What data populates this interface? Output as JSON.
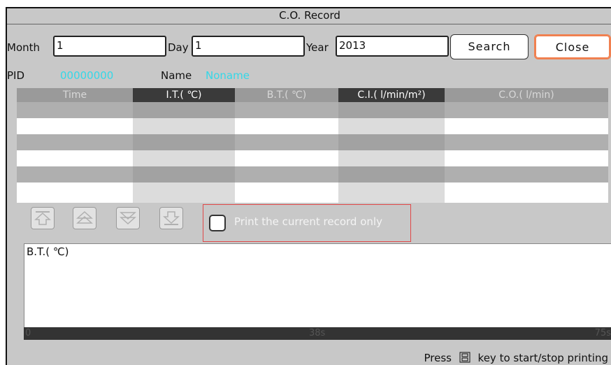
{
  "window": {
    "title": "C.O. Record"
  },
  "filters": {
    "month_label": "Month",
    "month_value": "1",
    "day_label": "Day",
    "day_value": "1",
    "year_label": "Year",
    "year_value": "2013",
    "search_label": "Search",
    "close_label": "Close"
  },
  "patient": {
    "pid_label": "PID",
    "pid_value": "00000000",
    "name_label": "Name",
    "name_value": "Noname"
  },
  "table": {
    "columns": [
      "Time",
      "I.T.( ℃)",
      "B.T.( ℃)",
      "C.I.( l/min/m²)",
      "C.O.( l/min)"
    ],
    "rows": [
      [],
      [],
      [],
      [],
      [],
      []
    ]
  },
  "navigation": {
    "buttons": [
      "first-page-icon",
      "page-up-icon",
      "page-down-icon",
      "last-page-icon"
    ]
  },
  "print_option": {
    "label": "Print the current record only",
    "checked": false
  },
  "waveform": {
    "label": "B.T.( ℃)",
    "time_ticks": [
      "0",
      "38s",
      "75s"
    ]
  },
  "footer": {
    "prefix": "Press",
    "key_icon": "print-key-icon",
    "suffix": "key to start/stop printing"
  },
  "colors": {
    "accent_cyan": "#34d8e8",
    "close_border": "#f08050",
    "print_box_border": "#e04848"
  }
}
